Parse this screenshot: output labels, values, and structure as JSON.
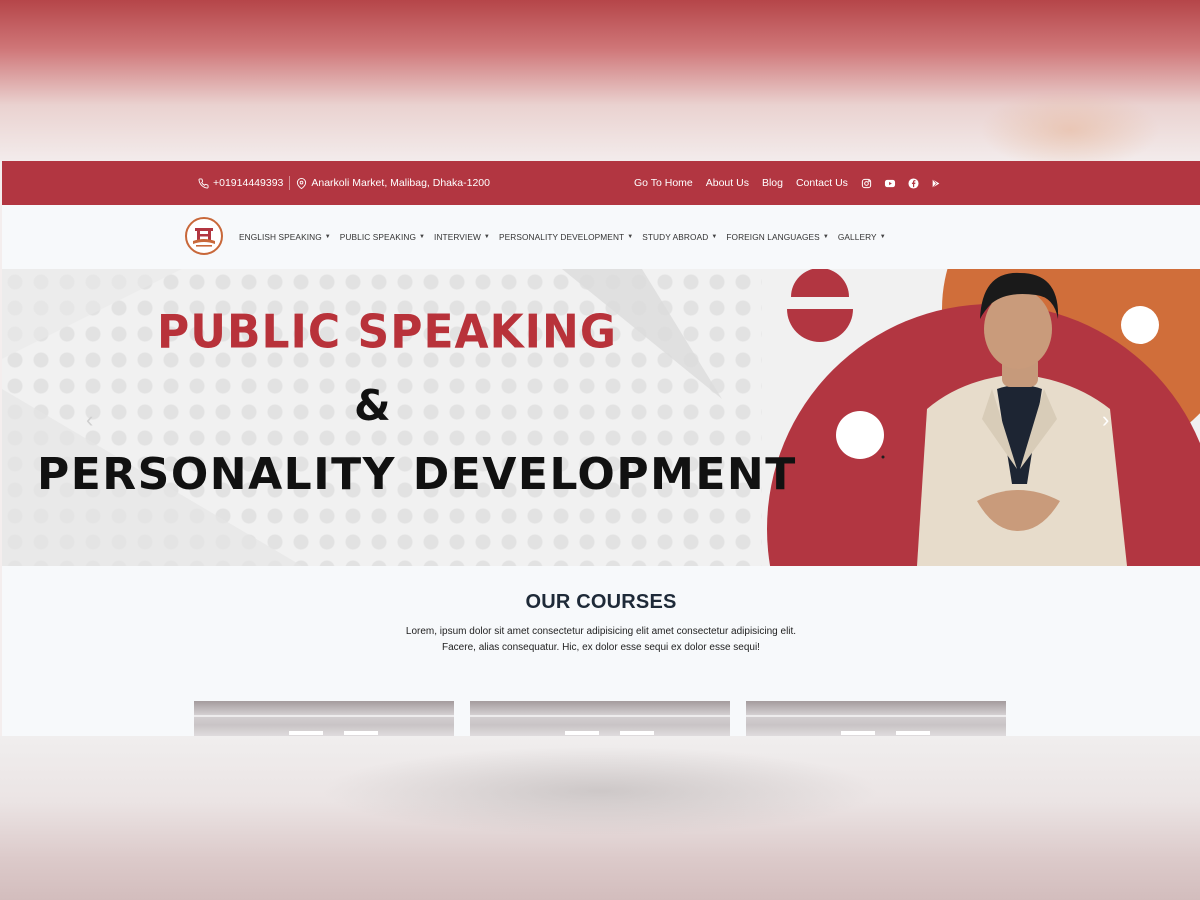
{
  "topbar": {
    "phone": "+01914449393",
    "address": "Anarkoli Market, Malibag, Dhaka-1200",
    "links": [
      "Go To Home",
      "About Us",
      "Blog",
      "Contact Us"
    ],
    "social_icons": [
      "instagram-icon",
      "youtube-icon",
      "facebook-icon",
      "google-play-icon"
    ]
  },
  "navbar": {
    "menu": [
      {
        "label": "ENGLISH SPEAKING"
      },
      {
        "label": "PUBLIC SPEAKING"
      },
      {
        "label": "INTERVIEW"
      },
      {
        "label": "PERSONALITY DEVELOPMENT"
      },
      {
        "label": "STUDY ABROAD"
      },
      {
        "label": "FOREIGN LANGUAGES"
      },
      {
        "label": "GALLERY"
      }
    ]
  },
  "hero": {
    "line1": "PUBLIC SPEAKING",
    "line2": "&",
    "line3": "PERSONALITY DEVELOPMENT",
    "prev_glyph": "‹",
    "next_glyph": "›"
  },
  "courses": {
    "heading": "OUR COURSES",
    "description": "Lorem, ipsum dolor sit amet consectetur adipisicing elit amet consectetur adipisicing elit. Facere, alias consequatur. Hic, ex dolor esse sequi ex dolor esse sequi!"
  },
  "colors": {
    "brand_red": "#b23641",
    "hero_red": "#b8323a",
    "accent_orange": "#d06e3a"
  }
}
